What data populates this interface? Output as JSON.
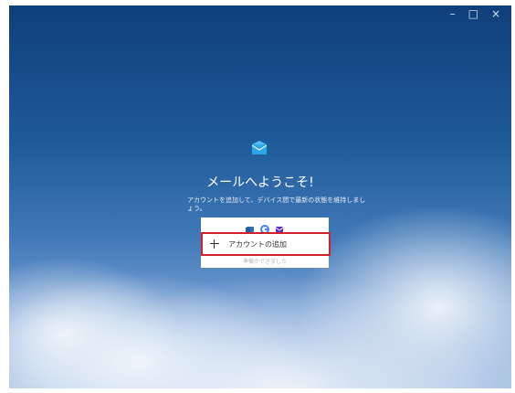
{
  "window": {
    "controls": {
      "minimize": "–",
      "maximize": "□",
      "close": "×"
    }
  },
  "welcome": {
    "title": "メールへようこそ!",
    "subtitle": "アカウントを追加して、デバイス間で最新の状態を維持しましょう。"
  },
  "providers": {
    "icons": [
      "outlook-icon",
      "google-icon",
      "yahoo-mail-icon"
    ]
  },
  "actions": {
    "add_account_label": "アカウントの追加",
    "ready_label": "準備ができました"
  },
  "colors": {
    "highlight": "#d1212a",
    "mail_icon": "#2aa7e6",
    "google_blue": "#4285F4",
    "yahoo_purple": "#5b2bbd",
    "outlook_blue": "#2f6fbd"
  }
}
